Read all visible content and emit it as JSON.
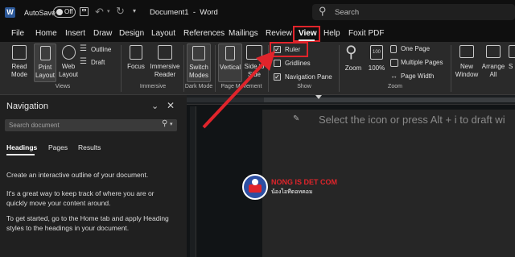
{
  "titlebar": {
    "autosave_label": "AutoSave",
    "autosave_state": "Off",
    "doc_title": "Document1  -  Word",
    "search_placeholder": "Search"
  },
  "menu": [
    "File",
    "Home",
    "Insert",
    "Draw",
    "Design",
    "Layout",
    "References",
    "Mailings",
    "Review",
    "View",
    "Help",
    "Foxit PDF"
  ],
  "ribbon": {
    "read_mode": "Read Mode",
    "print_layout": "Print Layout",
    "web_layout": "Web Layout",
    "outline": "Outline",
    "draft": "Draft",
    "views_group": "Views",
    "focus": "Focus",
    "immersive_reader": "Immersive Reader",
    "immersive_group": "Immersive",
    "switch_modes": "Switch Modes",
    "dark_mode_group": "Dark Mode",
    "vertical": "Vertical",
    "side_to_side": "Side to Side",
    "page_movement_group": "Page Movement",
    "ruler": "Ruler",
    "gridlines": "Gridlines",
    "navigation_pane": "Navigation Pane",
    "show_group": "Show",
    "zoom": "Zoom",
    "hundred": "100%",
    "hundred_icon": "100",
    "one_page": "One Page",
    "multiple_pages": "Multiple Pages",
    "page_width": "Page Width",
    "zoom_group": "Zoom",
    "new_window": "New Window",
    "arrange_all": "Arrange All",
    "split_partial": "S"
  },
  "nav": {
    "title": "Navigation",
    "search_placeholder": "Search document",
    "tabs": [
      "Headings",
      "Pages",
      "Results"
    ],
    "p1": "Create an interactive outline of your document.",
    "p2": "It's a great way to keep track of where you are or quickly move your content around.",
    "p3": "To get started, go to the Home tab and apply Heading styles to the headings in your document."
  },
  "doc": {
    "prompt": "Select the icon or press Alt + i to draft wi"
  },
  "watermark": {
    "name": "NONG IS DET COM",
    "tagline": "น้องไอทีดอทคอม"
  },
  "colors": {
    "accent": "#e0242b",
    "arrow": "#e0242b"
  }
}
